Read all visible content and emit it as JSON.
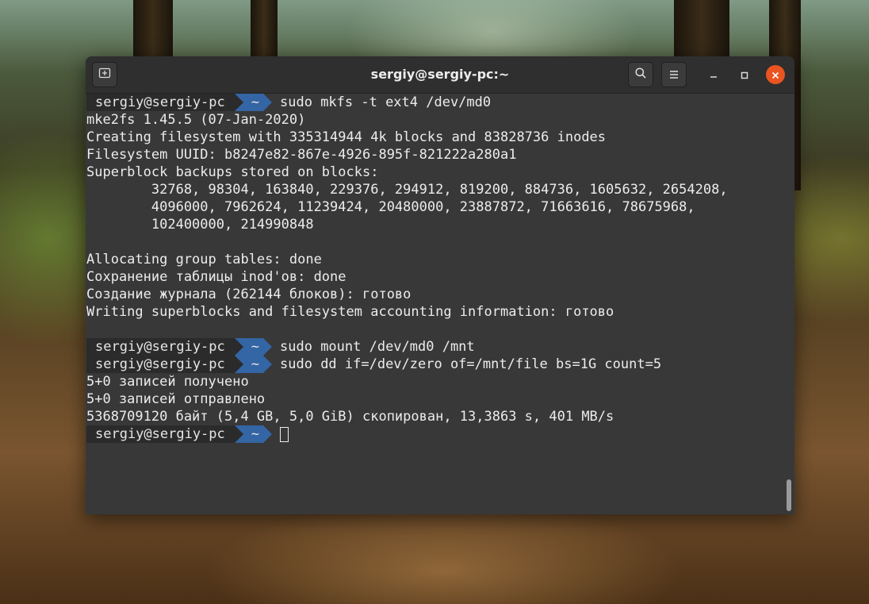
{
  "window": {
    "title": "sergiy@sergiy-pc:~"
  },
  "prompt": {
    "user": "sergiy@sergiy-pc",
    "dir": "~"
  },
  "terminal": {
    "lines": [
      {
        "type": "prompt",
        "cmd": "sudo mkfs -t ext4 /dev/md0"
      },
      {
        "type": "out",
        "text": "mke2fs 1.45.5 (07-Jan-2020)"
      },
      {
        "type": "out",
        "text": "Creating filesystem with 335314944 4k blocks and 83828736 inodes"
      },
      {
        "type": "out",
        "text": "Filesystem UUID: b8247e82-867e-4926-895f-821222a280a1"
      },
      {
        "type": "out",
        "text": "Superblock backups stored on blocks:"
      },
      {
        "type": "out",
        "text": "        32768, 98304, 163840, 229376, 294912, 819200, 884736, 1605632, 2654208,"
      },
      {
        "type": "out",
        "text": "        4096000, 7962624, 11239424, 20480000, 23887872, 71663616, 78675968,"
      },
      {
        "type": "out",
        "text": "        102400000, 214990848"
      },
      {
        "type": "out",
        "text": ""
      },
      {
        "type": "out",
        "text": "Allocating group tables: done"
      },
      {
        "type": "out",
        "text": "Сохранение таблицы inod'ов: done"
      },
      {
        "type": "out",
        "text": "Создание журнала (262144 блоков): готово"
      },
      {
        "type": "out",
        "text": "Writing superblocks and filesystem accounting information: готово"
      },
      {
        "type": "out",
        "text": ""
      },
      {
        "type": "prompt",
        "cmd": "sudo mount /dev/md0 /mnt"
      },
      {
        "type": "prompt",
        "cmd": "sudo dd if=/dev/zero of=/mnt/file bs=1G count=5"
      },
      {
        "type": "out",
        "text": "5+0 записей получено"
      },
      {
        "type": "out",
        "text": "5+0 записей отправлено"
      },
      {
        "type": "out",
        "text": "5368709120 байт (5,4 GB, 5,0 GiB) скопирован, 13,3863 s, 401 MB/s"
      },
      {
        "type": "prompt",
        "cmd": "",
        "cursor": true
      }
    ]
  },
  "colors": {
    "prompt_user_bg": "#2b2b2b",
    "prompt_dir_bg": "#3465a4",
    "close_button": "#e95420",
    "terminal_bg": "#383838"
  },
  "icons": {
    "new_tab": "new-tab-icon",
    "search": "search-icon",
    "menu": "hamburger-menu-icon",
    "minimize": "minimize-icon",
    "maximize": "maximize-icon",
    "close": "close-icon"
  }
}
